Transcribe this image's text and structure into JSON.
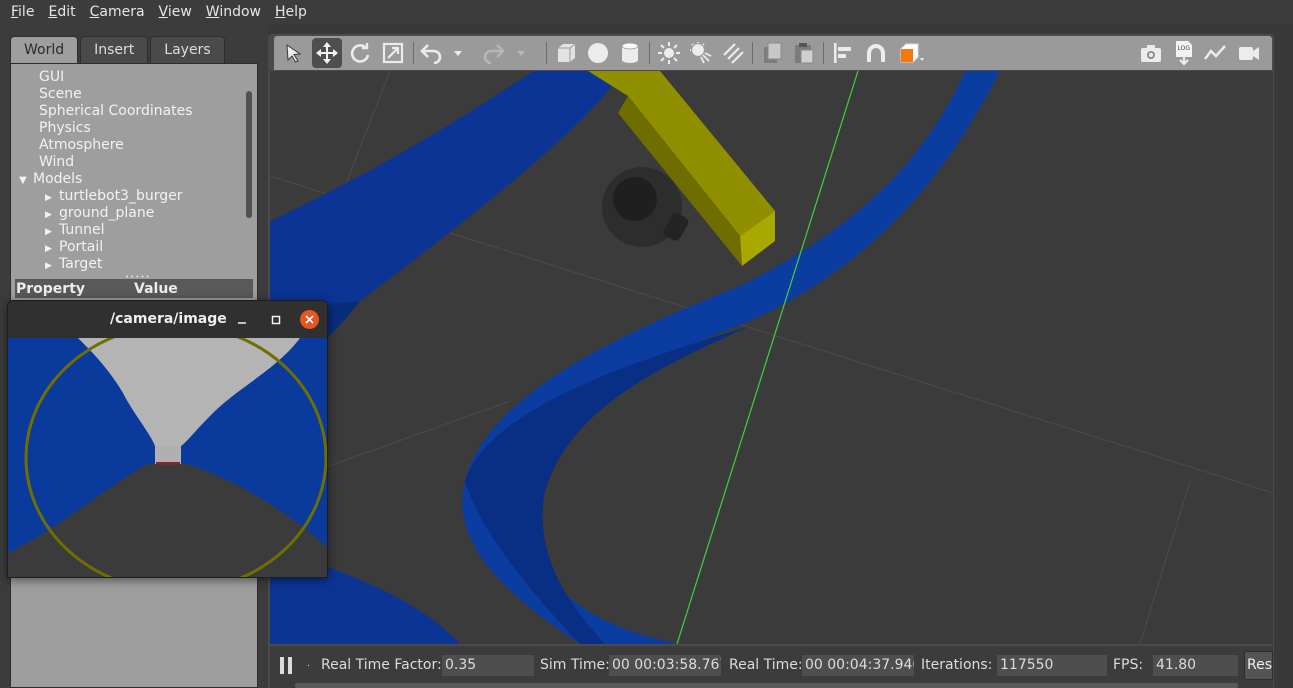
{
  "menu": [
    {
      "mnemonic": "F",
      "rest": "ile"
    },
    {
      "mnemonic": "E",
      "rest": "dit"
    },
    {
      "mnemonic": "C",
      "rest": "amera"
    },
    {
      "mnemonic": "V",
      "rest": "iew"
    },
    {
      "mnemonic": "W",
      "rest": "indow"
    },
    {
      "mnemonic": "H",
      "rest": "elp"
    }
  ],
  "left_panel": {
    "tabs": [
      "World",
      "Insert",
      "Layers"
    ],
    "active_tab": "World",
    "tree": {
      "gui": "GUI",
      "scene": "Scene",
      "spherical": "Spherical Coordinates",
      "physics": "Physics",
      "atmosphere": "Atmosphere",
      "wind": "Wind",
      "models": "Models",
      "model_items": [
        "turtlebot3_burger",
        "ground_plane",
        "Tunnel",
        "Portail",
        "Target"
      ]
    },
    "property_header": {
      "property": "Property",
      "value": "Value"
    }
  },
  "toolbar": {
    "icons": [
      "select-arrow",
      "translate",
      "rotate",
      "scale",
      "undo",
      "undo-history",
      "redo",
      "redo-history",
      "box",
      "sphere",
      "cylinder",
      "point-light",
      "spot-light",
      "directional-light",
      "copy",
      "paste",
      "align",
      "snap",
      "view-angle",
      "screenshot",
      "log",
      "plot",
      "record-video"
    ],
    "active": "translate",
    "log_label": "LOG"
  },
  "bottom_bar": {
    "real_time_factor_label": "Real Time Factor:",
    "real_time_factor": "0.35",
    "sim_time_label": "Sim Time:",
    "sim_time": "00 00:03:58.767",
    "real_time_label": "Real Time:",
    "real_time": "00 00:04:37.946",
    "iterations_label": "Iterations:",
    "iterations": "117550",
    "fps_label": "FPS:",
    "fps": "41.80",
    "reset_label": "Reset"
  },
  "camera_window": {
    "title": "/camera/image"
  },
  "colors": {
    "tunnel_blue": "#0a3a9c",
    "target_yellow": "#8b8b00",
    "ground": "#3b3b3b",
    "close_button": "#e95420"
  }
}
